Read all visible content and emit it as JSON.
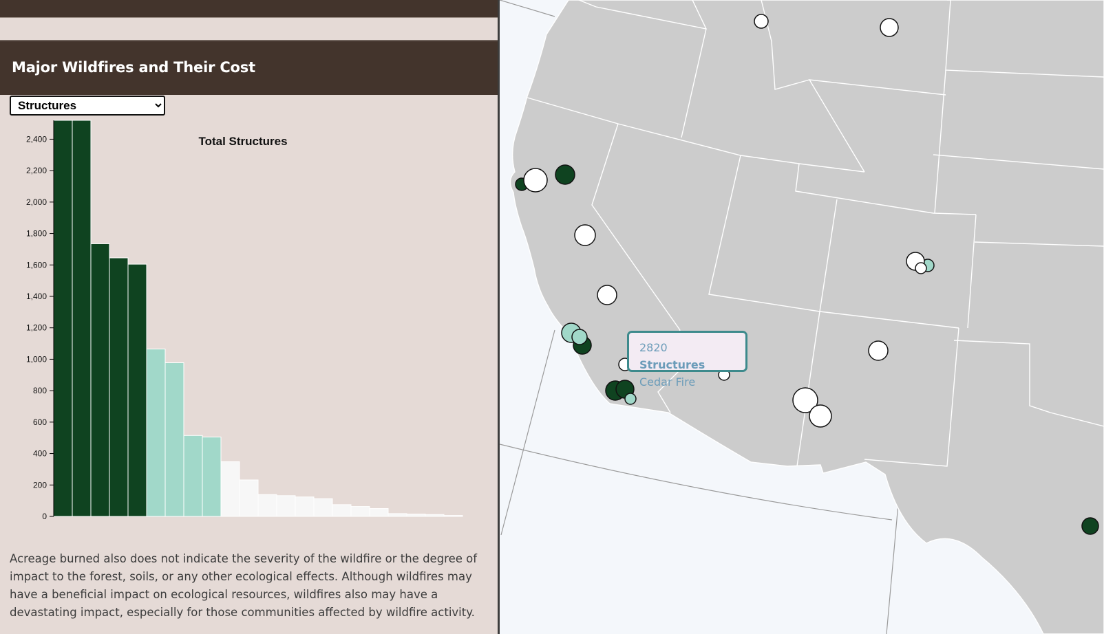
{
  "header": {
    "title": "Major Wildfires and Their Cost"
  },
  "selector": {
    "value": "Structures",
    "options": [
      "Structures"
    ]
  },
  "chart_data": {
    "type": "bar",
    "title": "Total Structures",
    "ylim": [
      0,
      2520
    ],
    "yticks": [
      0,
      200,
      400,
      600,
      800,
      1000,
      1200,
      1400,
      1600,
      1800,
      2000,
      2200,
      2400
    ],
    "values": [
      2820,
      2820,
      1735,
      1645,
      1605,
      1065,
      978,
      515,
      505,
      348,
      232,
      139,
      132,
      124,
      113,
      75,
      63,
      50,
      18,
      15,
      12,
      6
    ],
    "colors": {
      "high": "#0f4320",
      "mid": "#a1d8c9",
      "low": "#f7f7f7",
      "stroke": "#ffffff"
    },
    "color_groups": [
      "high",
      "high",
      "high",
      "high",
      "high",
      "mid",
      "mid",
      "mid",
      "mid",
      "low",
      "low",
      "low",
      "low",
      "low",
      "low",
      "low",
      "low",
      "low",
      "low",
      "low",
      "low",
      "low"
    ],
    "grid": false
  },
  "body": {
    "paragraph": "Acreage burned also does not indicate the severity of the wildfire or the degree of impact to the forest, soils, or any other ecological effects. Although wildfires may have a beneficial impact on ecological resources, wildfires also may have a devastating impact, especially for those communities affected by wildfire activity."
  },
  "map": {
    "colors": {
      "water": "#f4f7fb",
      "land": "#cccccc",
      "border": "#ffffff",
      "graticule": "#9a9a9a"
    },
    "tooltip": {
      "value": "2820",
      "metric": "Structures",
      "fire": "Cedar Fire"
    }
  }
}
